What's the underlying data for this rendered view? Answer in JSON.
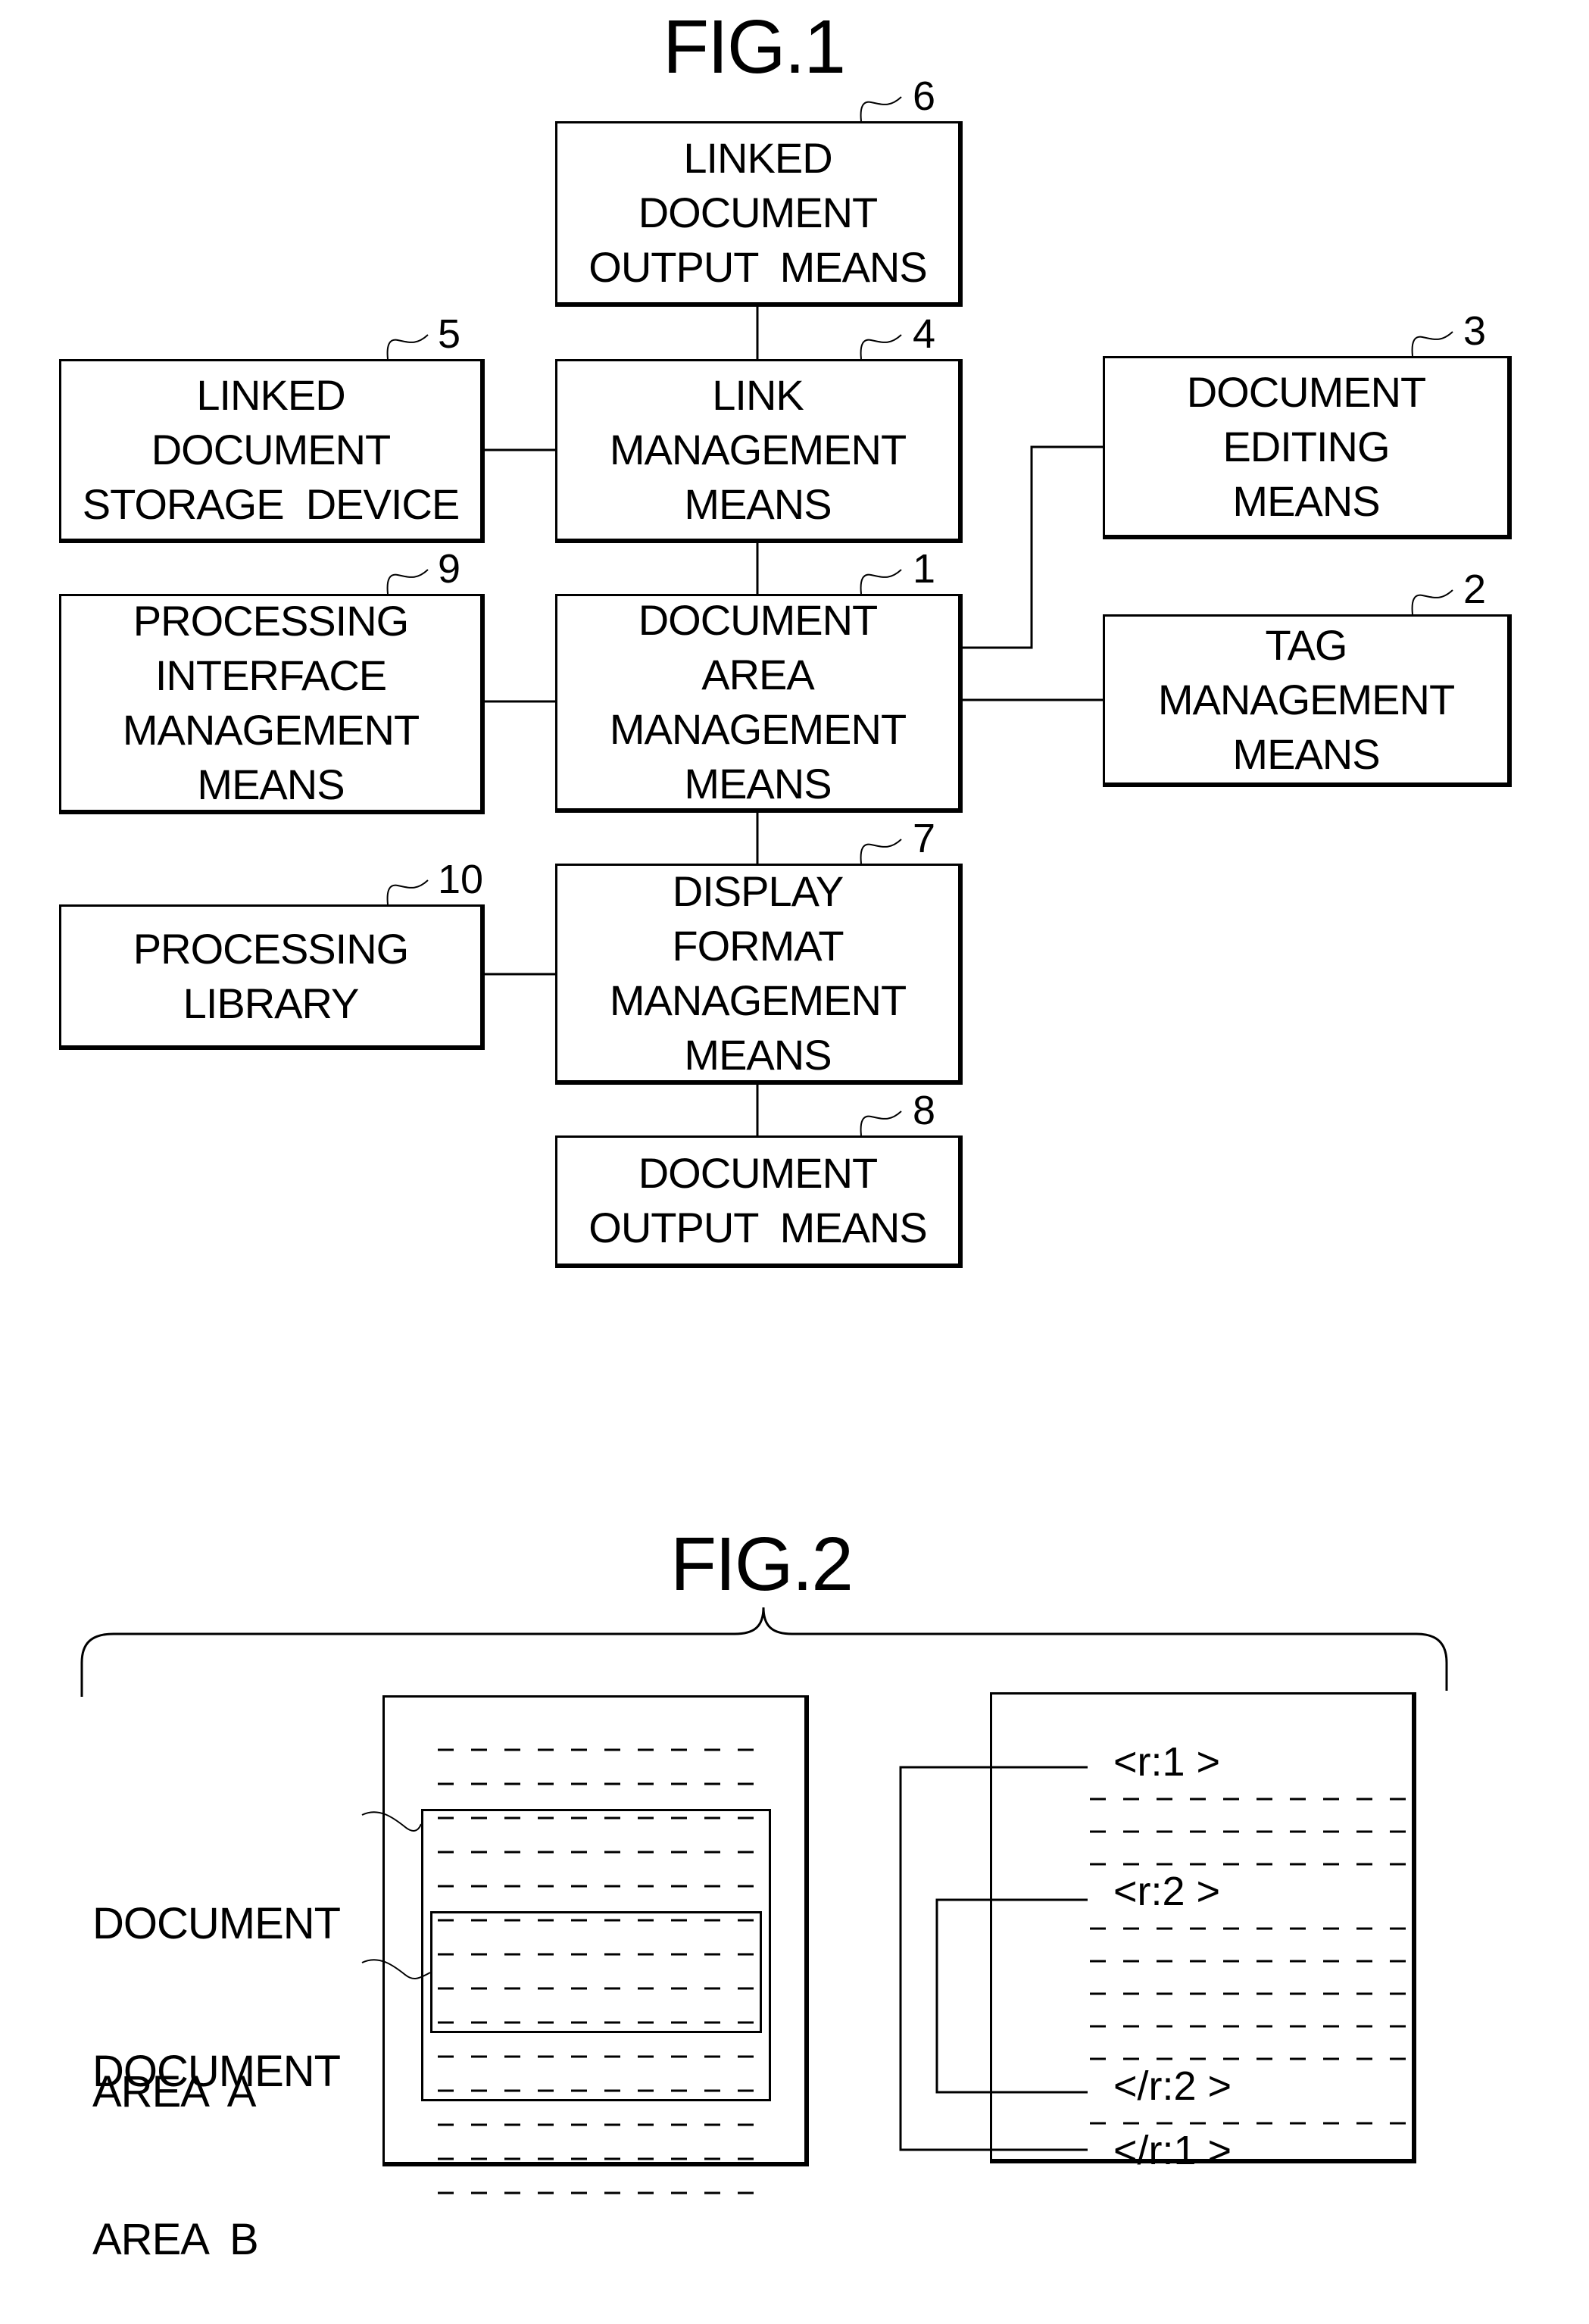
{
  "fig1": {
    "title": "FIG.1",
    "blocks": [
      {
        "id": "1",
        "ref": "1",
        "lines": [
          "DOCUMENT",
          "AREA",
          "MANAGEMENT",
          "MEANS"
        ]
      },
      {
        "id": "2",
        "ref": "2",
        "lines": [
          "TAG",
          "MANAGEMENT",
          "MEANS"
        ]
      },
      {
        "id": "3",
        "ref": "3",
        "lines": [
          "DOCUMENT",
          "EDITING",
          "MEANS"
        ]
      },
      {
        "id": "4",
        "ref": "4",
        "lines": [
          "LINK",
          "MANAGEMENT",
          "MEANS"
        ]
      },
      {
        "id": "5",
        "ref": "5",
        "lines": [
          "LINKED",
          "DOCUMENT",
          "STORAGE  DEVICE"
        ]
      },
      {
        "id": "6",
        "ref": "6",
        "lines": [
          "LINKED",
          "DOCUMENT",
          "OUTPUT  MEANS"
        ]
      },
      {
        "id": "7",
        "ref": "7",
        "lines": [
          "DISPLAY",
          "FORMAT",
          "MANAGEMENT",
          "MEANS"
        ]
      },
      {
        "id": "8",
        "ref": "8",
        "lines": [
          "DOCUMENT",
          "OUTPUT  MEANS"
        ]
      },
      {
        "id": "9",
        "ref": "9",
        "lines": [
          "PROCESSING",
          "INTERFACE",
          "MANAGEMENT",
          "MEANS"
        ]
      },
      {
        "id": "10",
        "ref": "10",
        "lines": [
          "PROCESSING",
          "LIBRARY"
        ]
      }
    ],
    "connections": [
      [
        "6",
        "4"
      ],
      [
        "4",
        "5"
      ],
      [
        "4",
        "1"
      ],
      [
        "1",
        "3"
      ],
      [
        "1",
        "2"
      ],
      [
        "1",
        "9"
      ],
      [
        "1",
        "7"
      ],
      [
        "7",
        "10"
      ],
      [
        "7",
        "8"
      ]
    ]
  },
  "fig2": {
    "title": "FIG.2",
    "left_document": {
      "line_count": 14,
      "dashes_per_line": 10,
      "area_a": {
        "label_lines": [
          "DOCUMENT",
          "AREA  A"
        ],
        "first_line": 3,
        "last_line": 11
      },
      "area_b": {
        "label_lines": [
          "DOCUMENT",
          "AREA  B"
        ],
        "first_line": 6,
        "last_line": 9
      }
    },
    "right_document": {
      "sequence": [
        {
          "type": "tag",
          "text": "<r:1 >"
        },
        {
          "type": "lines",
          "count": 3
        },
        {
          "type": "tag",
          "text": "<r:2 >"
        },
        {
          "type": "lines",
          "count": 5
        },
        {
          "type": "tag",
          "text": "</r:2 >"
        },
        {
          "type": "lines",
          "count": 1
        },
        {
          "type": "tag",
          "text": "</r:1 >"
        }
      ],
      "dashes_per_line": 10,
      "tag_pairs": [
        {
          "open": "<r:1 >",
          "close": "</r:1 >"
        },
        {
          "open": "<r:2 >",
          "close": "</r:2 >"
        }
      ]
    }
  }
}
